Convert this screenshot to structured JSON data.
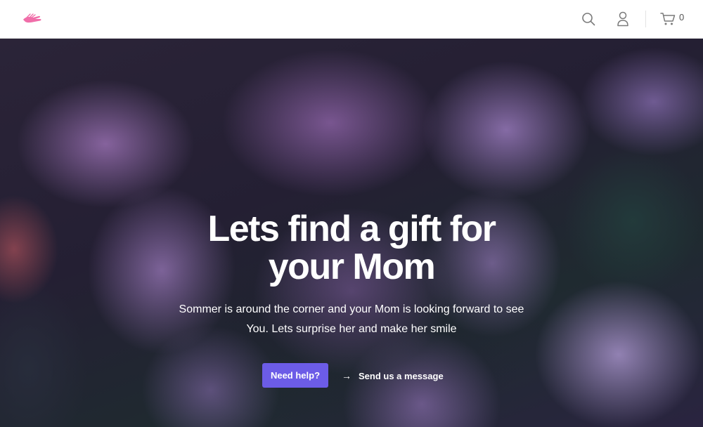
{
  "header": {
    "logo_icon": "hand-icon",
    "search_icon": "search-icon",
    "account_icon": "user-icon",
    "cart_icon": "cart-icon",
    "cart_count": "0",
    "accent_color": "#f06ea9"
  },
  "hero": {
    "title_line1": "Lets find a gift for",
    "title_line2": "your Mom",
    "subtitle_line1": "Sommer is around the corner and your Mom is looking forward to see",
    "subtitle_line2": "You. Lets surprise her and make her smile",
    "primary_button": "Need help?",
    "primary_color": "#6c5ce7",
    "secondary_arrow": "→",
    "secondary_link": "Send us a message"
  }
}
